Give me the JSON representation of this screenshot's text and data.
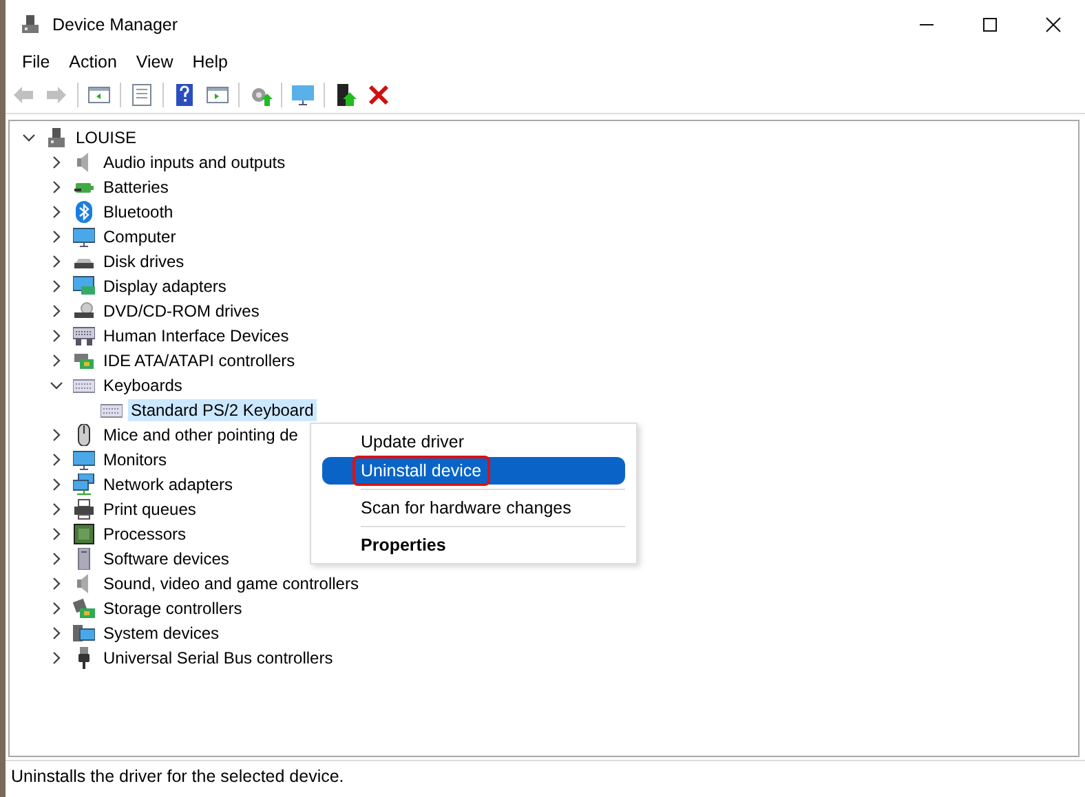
{
  "window": {
    "title": "Device Manager"
  },
  "menu_bar": [
    "File",
    "Action",
    "View",
    "Help"
  ],
  "toolbar": [
    {
      "buttons": [
        {
          "kind": "back",
          "disabled": true
        },
        {
          "kind": "forward",
          "disabled": true
        }
      ]
    },
    {
      "buttons": [
        {
          "kind": "tree-pane",
          "disabled": false
        }
      ]
    },
    {
      "buttons": [
        {
          "kind": "properties",
          "disabled": false
        }
      ]
    },
    {
      "buttons": [
        {
          "kind": "help",
          "disabled": false
        },
        {
          "kind": "action-pane",
          "disabled": false
        }
      ]
    },
    {
      "buttons": [
        {
          "kind": "scan",
          "disabled": false
        }
      ]
    },
    {
      "buttons": [
        {
          "kind": "monitor",
          "disabled": false
        }
      ]
    },
    {
      "buttons": [
        {
          "kind": "update",
          "disabled": false
        },
        {
          "kind": "uninstall",
          "disabled": false
        }
      ]
    }
  ],
  "tree": {
    "label": "LOUISE",
    "kind": "computer-tower",
    "expanded": true,
    "selected": false,
    "children": [
      {
        "label": "Audio inputs and outputs",
        "kind": "speaker",
        "expanded": false,
        "selected": false
      },
      {
        "label": "Batteries",
        "kind": "battery",
        "expanded": false,
        "selected": false
      },
      {
        "label": "Bluetooth",
        "kind": "bluetooth",
        "expanded": false,
        "selected": false
      },
      {
        "label": "Computer",
        "kind": "monitor",
        "expanded": false,
        "selected": false
      },
      {
        "label": "Disk drives",
        "kind": "drive",
        "expanded": false,
        "selected": false
      },
      {
        "label": "Display adapters",
        "kind": "display",
        "expanded": false,
        "selected": false
      },
      {
        "label": "DVD/CD-ROM drives",
        "kind": "disc",
        "expanded": false,
        "selected": false
      },
      {
        "label": "Human Interface Devices",
        "kind": "hid",
        "expanded": false,
        "selected": false
      },
      {
        "label": "IDE ATA/ATAPI controllers",
        "kind": "card",
        "expanded": false,
        "selected": false
      },
      {
        "label": "Keyboards",
        "kind": "keyboard",
        "expanded": true,
        "selected": false,
        "children": [
          {
            "label": "Standard PS/2 Keyboard",
            "kind": "keyboard",
            "selected": true
          }
        ]
      },
      {
        "label": "Mice and other pointing de",
        "kind": "mouse",
        "expanded": false,
        "selected": false
      },
      {
        "label": "Monitors",
        "kind": "monitor",
        "expanded": false,
        "selected": false
      },
      {
        "label": "Network adapters",
        "kind": "network",
        "expanded": false,
        "selected": false
      },
      {
        "label": "Print queues",
        "kind": "printer",
        "expanded": false,
        "selected": false
      },
      {
        "label": "Processors",
        "kind": "chip",
        "expanded": false,
        "selected": false
      },
      {
        "label": "Software devices",
        "kind": "software",
        "expanded": false,
        "selected": false
      },
      {
        "label": "Sound, video and game controllers",
        "kind": "speaker",
        "expanded": false,
        "selected": false
      },
      {
        "label": "Storage controllers",
        "kind": "storage",
        "expanded": false,
        "selected": false
      },
      {
        "label": "System devices",
        "kind": "system",
        "expanded": false,
        "selected": false
      },
      {
        "label": "Universal Serial Bus controllers",
        "kind": "usb",
        "expanded": false,
        "selected": false
      }
    ]
  },
  "context_menu": [
    {
      "kind": "item",
      "label": "Update driver",
      "selected": false,
      "bold": false,
      "outlined": false
    },
    {
      "kind": "item",
      "label": "Uninstall device",
      "selected": true,
      "bold": false,
      "outlined": true
    },
    {
      "kind": "separator"
    },
    {
      "kind": "item",
      "label": "Scan for hardware changes",
      "selected": false,
      "bold": false,
      "outlined": false
    },
    {
      "kind": "separator"
    },
    {
      "kind": "item",
      "label": "Properties",
      "selected": false,
      "bold": true,
      "outlined": false
    }
  ],
  "status_bar": "Uninstalls the driver for the selected device."
}
